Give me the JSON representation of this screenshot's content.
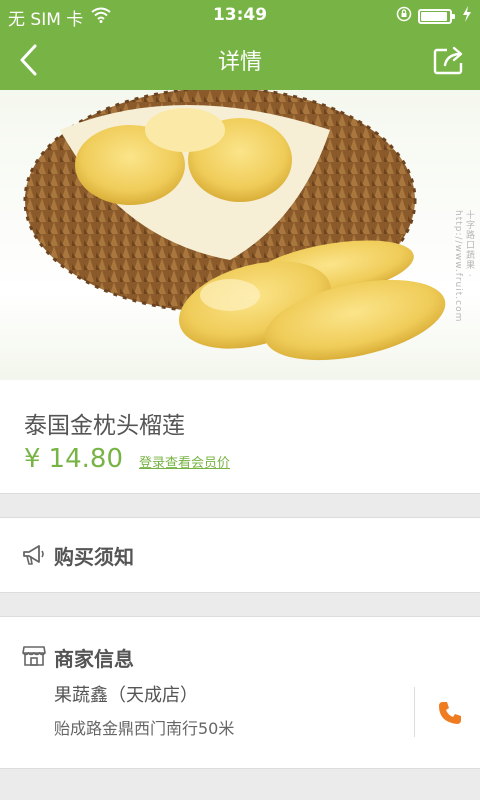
{
  "status_bar": {
    "carrier": "无 SIM 卡",
    "time": "13:49"
  },
  "nav": {
    "title": "详情"
  },
  "product": {
    "name": "泰国金枕头榴莲",
    "currency": "¥",
    "price": "14.80",
    "member_link": "登录查看会员价",
    "watermark": "十字路口蔬果 · http://www.fruit.com"
  },
  "notice": {
    "label": "购买须知"
  },
  "merchant": {
    "section_label": "商家信息",
    "name": "果蔬鑫（天成店）",
    "address": "贻成路金鼎西门南行50米"
  },
  "colors": {
    "brand_green": "#78b445",
    "phone_orange": "#f07c22"
  },
  "icons": {
    "back": "chevron-left-icon",
    "share": "share-icon",
    "notice": "megaphone-icon",
    "merchant": "store-icon",
    "phone": "phone-icon",
    "wifi": "wifi-icon",
    "lock": "rotation-lock-icon",
    "battery": "battery-icon",
    "charging": "charging-bolt-icon"
  }
}
